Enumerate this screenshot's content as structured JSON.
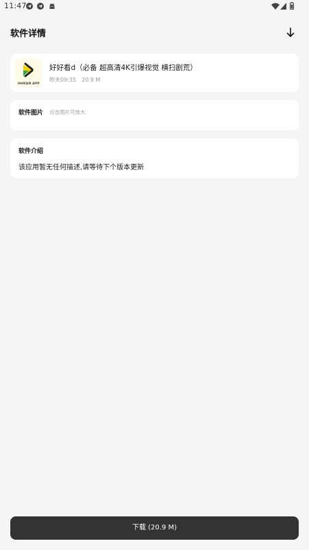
{
  "status_bar": {
    "time": "11:47",
    "left_icons": [
      "telegram-icon",
      "telegram-icon",
      "android-icon"
    ],
    "right_icons": [
      "wifi-icon",
      "signal-icon",
      "battery-icon"
    ]
  },
  "header": {
    "title": "软件详情",
    "action_icon": "download-arrow-icon"
  },
  "app": {
    "name": "好好看d（必备 超高清4K引爆视觉 横扫剧荒）",
    "date": "昨天09:35",
    "size": "20.9 M",
    "icon_caption": "HHKAN APP",
    "icon_colors": {
      "background": "#fffbe6",
      "yellow": "#f5d10a",
      "green": "#2aa84a",
      "dark": "#222222"
    }
  },
  "images_section": {
    "label": "软件图片",
    "hint": "点击图片可放大"
  },
  "intro_section": {
    "label": "软件介绍",
    "text": "该应用暂无任何描述,请等待下个版本更新"
  },
  "download_button": {
    "label": "下载 (20.9 M)"
  },
  "colors": {
    "page_background": "#f5f5f5",
    "card_background": "#ffffff",
    "button_background": "#333333",
    "button_text": "#ffffff",
    "secondary_text": "#9a9a9a"
  }
}
